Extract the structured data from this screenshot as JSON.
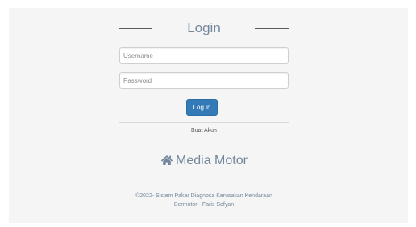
{
  "login": {
    "title": "Login",
    "username_placeholder": "Username",
    "password_placeholder": "Password",
    "submit_label": "Log in",
    "register_link": "Buat Akun"
  },
  "brand": {
    "icon": "home-icon",
    "name": "Media Motor"
  },
  "footer": {
    "line1": "©2022- Sistem Pakar Diagnosa Kerusakan Kendaraan",
    "line2": "Bermotor - Faris Sofyan"
  },
  "colors": {
    "panel_background": "#f5f5f5",
    "heading_text": "#73879c",
    "button_primary": "#337ab7"
  }
}
